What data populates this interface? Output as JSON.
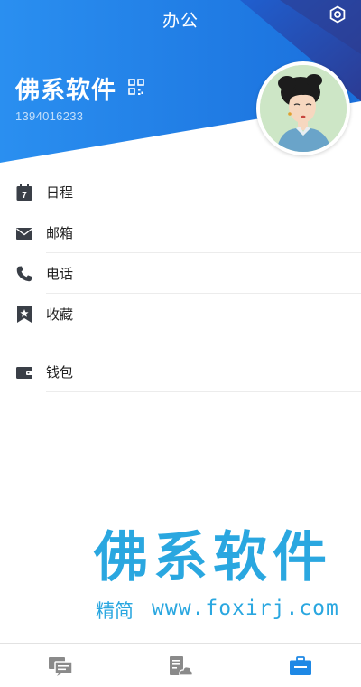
{
  "header": {
    "title": "办公",
    "settings_icon": "settings-hexagon-icon",
    "qr_icon": "qr-code-icon",
    "colors": {
      "blue_light": "#2a8ff0",
      "blue_dark": "#1766d6",
      "indigo": "#2e3a8c"
    }
  },
  "profile": {
    "name": "佛系软件",
    "phone": "1394016233",
    "avatar": "avatar-illustration"
  },
  "menu": [
    {
      "id": "schedule",
      "label": "日程",
      "icon": "calendar-icon",
      "icon_text": "7"
    },
    {
      "id": "mailbox",
      "label": "邮箱",
      "icon": "mail-icon"
    },
    {
      "id": "phone",
      "label": "电话",
      "icon": "phone-icon"
    },
    {
      "id": "favorites",
      "label": "收藏",
      "icon": "bookmark-star-icon"
    },
    {
      "id": "wallet",
      "label": "钱包",
      "icon": "wallet-icon"
    }
  ],
  "watermark": {
    "main": "佛系软件",
    "sub": "精简",
    "url": "www.foxirj.com",
    "color": "#2aa7e0"
  },
  "tabbar": {
    "tabs": [
      {
        "id": "messages",
        "icon": "chat-bubbles-icon",
        "active": false
      },
      {
        "id": "docs",
        "icon": "document-cloud-icon",
        "active": false
      },
      {
        "id": "office",
        "icon": "briefcase-icon",
        "active": true
      }
    ],
    "colors": {
      "inactive": "#8a8a8a",
      "active": "#1e88e5"
    }
  }
}
